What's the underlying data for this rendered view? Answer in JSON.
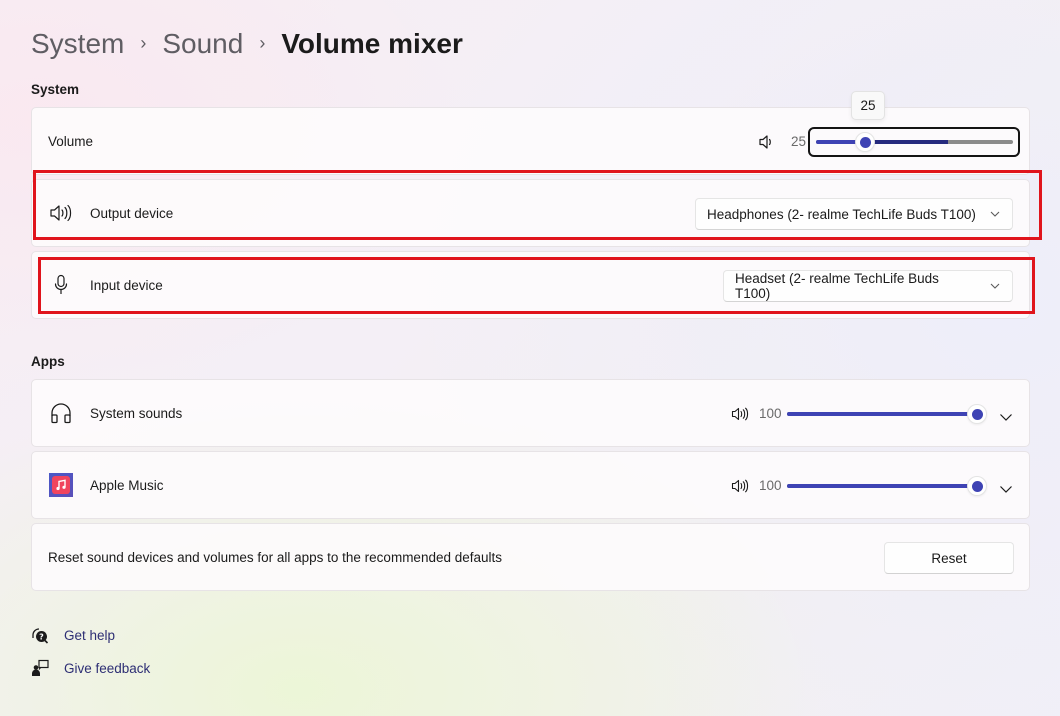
{
  "breadcrumb": {
    "items": [
      "System",
      "Sound"
    ],
    "current": "Volume mixer",
    "separator": "›"
  },
  "system_section": {
    "label": "System",
    "volume": {
      "label": "Volume",
      "value_text": "25",
      "value": 25,
      "max": 100,
      "peak_level": 0.67,
      "tooltip": "25",
      "icon": "speaker-low-icon"
    },
    "output_device": {
      "label": "Output device",
      "icon": "speaker-icon",
      "selected": "Headphones (2- realme TechLife Buds T100)"
    },
    "input_device": {
      "label": "Input device",
      "icon": "microphone-icon",
      "selected": "Headset (2- realme TechLife Buds T100)"
    }
  },
  "apps_section": {
    "label": "Apps",
    "apps": [
      {
        "name": "System sounds",
        "icon": "headphones-icon",
        "volume_text": "100",
        "volume": 100
      },
      {
        "name": "Apple Music",
        "icon": "apple-music-icon",
        "volume_text": "100",
        "volume": 100
      }
    ]
  },
  "reset": {
    "description": "Reset sound devices and volumes for all apps to the recommended defaults",
    "button_label": "Reset"
  },
  "footer_links": [
    {
      "label": "Get help",
      "icon": "help-icon"
    },
    {
      "label": "Give feedback",
      "icon": "feedback-icon"
    }
  ],
  "colors": {
    "accent": "#3e43b4",
    "peak": "#252a7e",
    "highlight_box": "#e0141c",
    "link": "#2d2e74"
  }
}
